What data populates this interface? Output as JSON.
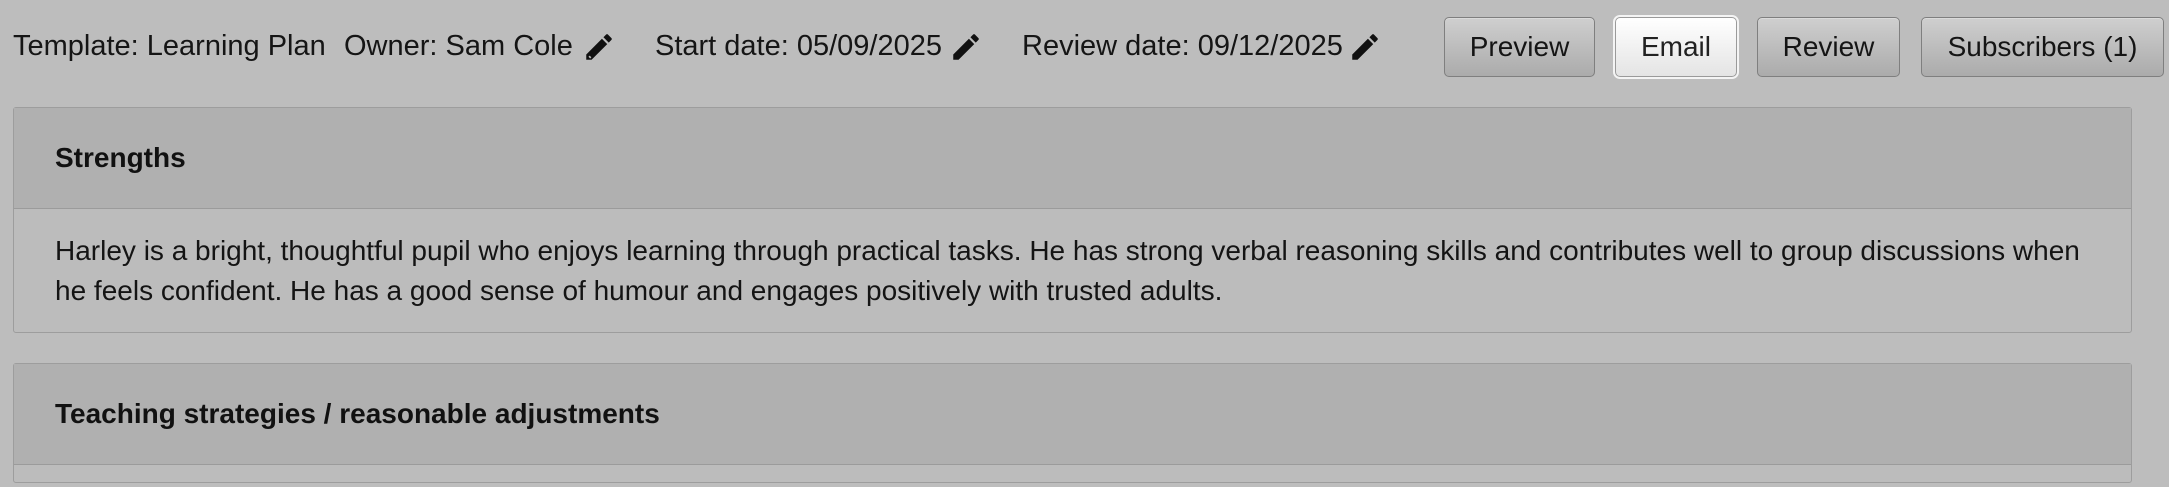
{
  "header": {
    "template": "Template: Learning Plan",
    "owner": "Owner: Sam Cole",
    "start_date": "Start date: 05/09/2025",
    "review_date": "Review date: 09/12/2025"
  },
  "toolbar": {
    "preview_label": "Preview",
    "email_label": "Email",
    "review_label": "Review",
    "subscribers_label": "Subscribers (1)"
  },
  "sections": [
    {
      "title": "Strengths",
      "body": "Harley is a bright, thoughtful pupil who enjoys learning through practical tasks. He has strong verbal reasoning skills and contributes well to group discussions when he feels confident. He has a good sense of humour and engages positively with trusted adults."
    },
    {
      "title": "Teaching strategies / reasonable adjustments",
      "body": ""
    }
  ],
  "icons": {
    "edit": "pencil-icon"
  }
}
